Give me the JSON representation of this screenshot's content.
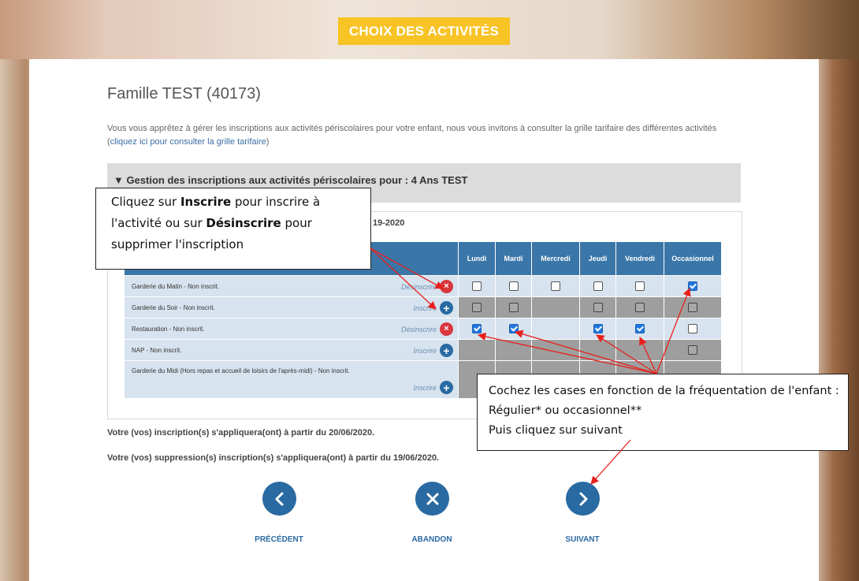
{
  "header": {
    "title": "CHOIX DES ACTIVITÉS"
  },
  "family": {
    "title": "Famille TEST (40173)"
  },
  "intro": {
    "text_before": "Vous vous apprêtez à gérer les inscriptions aux activités périscolaires pour votre enfant, nous vous invitons à consulter la grille tarifaire des différentes activités (",
    "link": "cliquez ici pour consulter la grille tarifaire",
    "text_after": ")"
  },
  "section": {
    "title": "▼ Gestion des inscriptions aux activités périscolaires pour : 4 Ans TEST"
  },
  "year_fragment": "19-2020",
  "grid": {
    "days": [
      "Lundi",
      "Mardi",
      "Mercredi",
      "Jeudi",
      "Vendredi",
      "Occasionnel"
    ],
    "rows": [
      {
        "name": "Garderie du Matin - Non inscrit.",
        "action": "Désinscrire",
        "action_icon": "remove-circle-icon"
      },
      {
        "name": "Garderie du Soir - Non inscrit.",
        "action": "Inscrire",
        "action_icon": "add-circle-icon"
      },
      {
        "name": "Restauration - Non inscrit.",
        "action": "Désinscrire",
        "action_icon": "remove-circle-icon"
      },
      {
        "name": "NAP - Non inscrit.",
        "action": "Inscrire",
        "action_icon": "add-circle-icon"
      },
      {
        "name": "Garderie du Midi (Hors repas et accueil de loisirs de l'après-midi) - Non inscrit.",
        "action": "Inscrire",
        "action_icon": "add-circle-icon"
      }
    ],
    "checks": [
      [
        false,
        false,
        false,
        false,
        false,
        true
      ],
      [
        false,
        false,
        null,
        false,
        false,
        false
      ],
      [
        true,
        true,
        null,
        true,
        true,
        false
      ],
      [
        null,
        null,
        null,
        null,
        null,
        false
      ],
      [
        null,
        null,
        null,
        null,
        null,
        null
      ]
    ]
  },
  "notes": {
    "apply": "Votre (vos) inscription(s) s'appliquera(ont) à partir du 20/06/2020.",
    "remove": "Votre (vos) suppression(s) inscription(s) s'appliquera(ont) à partir du 19/06/2020."
  },
  "nav": {
    "prev": "PRÉCÉDENT",
    "abort": "ABANDON",
    "next": "SUIVANT"
  },
  "callout1": {
    "p1": "Cliquez sur ",
    "b1": "Inscrire",
    "p2": " pour inscrire à l'activité ou sur ",
    "b2": "Désinscrire",
    "p3": " pour supprimer l'inscription"
  },
  "callout2": {
    "line1": "Cochez les cases en fonction de la fréquentation de l'enfant : Régulier* ou occasionnel**",
    "line2": "Puis cliquez sur suivant"
  },
  "colors": {
    "accent_yellow": "#f7c325",
    "table_header": "#3a76a8",
    "remove_red": "#d9363e",
    "nav_blue": "#2a6aa2",
    "arrow_red": "#e8201c"
  }
}
